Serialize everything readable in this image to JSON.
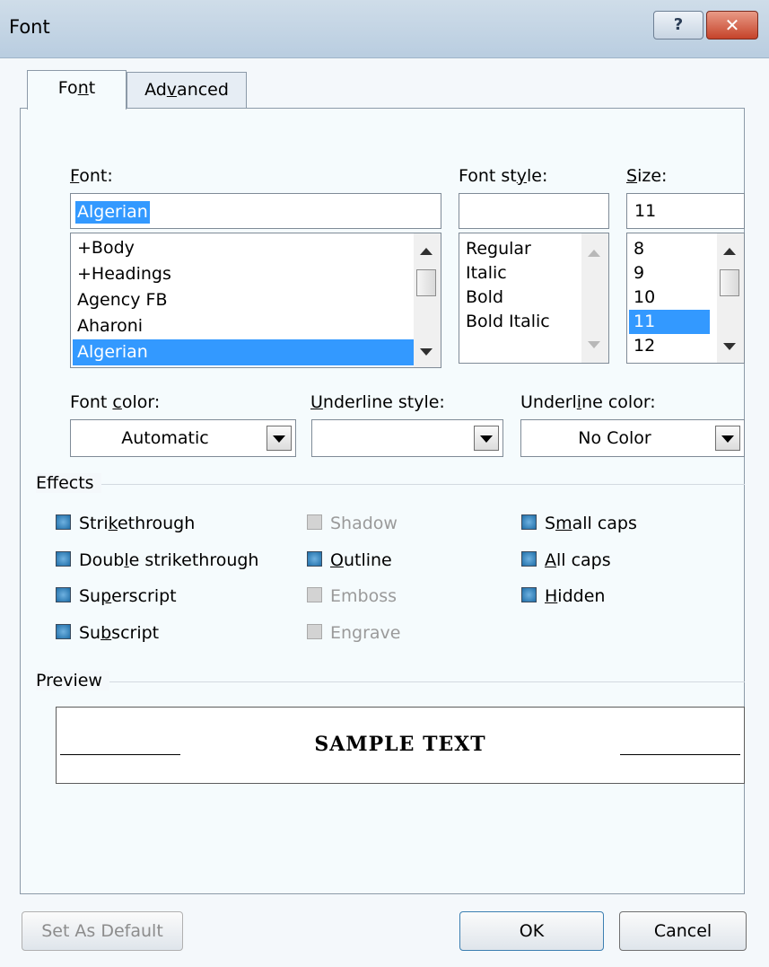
{
  "window": {
    "title": "Font",
    "help_button": "?",
    "close_button": "✕"
  },
  "tabs": [
    {
      "label": "Font",
      "mnemonic_pre": "Fo",
      "mnemonic": "n",
      "mnemonic_post": "t"
    },
    {
      "label": "Advanced",
      "mnemonic_pre": "Ad",
      "mnemonic": "v",
      "mnemonic_post": "anced"
    }
  ],
  "font": {
    "label_pre": "",
    "label_key": "F",
    "label_post": "ont:",
    "value": "Algerian",
    "items": [
      "+Body",
      "+Headings",
      "Agency FB",
      "Aharoni",
      "Algerian"
    ],
    "selected_index": 4
  },
  "font_style": {
    "label_pre": "Font st",
    "label_key": "y",
    "label_post": "le:",
    "value": "",
    "items": [
      "Regular",
      "Italic",
      "Bold",
      "Bold Italic"
    ]
  },
  "size": {
    "label_pre": "",
    "label_key": "S",
    "label_post": "ize:",
    "value": "11",
    "items": [
      "8",
      "9",
      "10",
      "11",
      "12"
    ],
    "selected_index": 3
  },
  "font_color": {
    "label_pre": "Font ",
    "label_key": "c",
    "label_post": "olor:",
    "value": "Automatic"
  },
  "underline_style": {
    "label_pre": "",
    "label_key": "U",
    "label_post": "nderline style:",
    "value": ""
  },
  "underline_color": {
    "label_pre": "Underl",
    "label_key": "i",
    "label_post": "ne color:",
    "value": "No Color"
  },
  "effects": {
    "title": "Effects",
    "items": [
      {
        "pre": "Stri",
        "key": "k",
        "post": "ethrough",
        "enabled": true
      },
      {
        "pre": "Doub",
        "key": "l",
        "post": "e strikethrough",
        "enabled": true
      },
      {
        "pre": "Su",
        "key": "p",
        "post": "erscript",
        "enabled": true
      },
      {
        "pre": "Su",
        "key": "b",
        "post": "script",
        "enabled": true
      },
      {
        "pre": "",
        "key": "",
        "post": "Shadow",
        "enabled": false
      },
      {
        "pre": "",
        "key": "O",
        "post": "utline",
        "enabled": true
      },
      {
        "pre": "",
        "key": "",
        "post": "Emboss",
        "enabled": false
      },
      {
        "pre": "",
        "key": "",
        "post": "Engrave",
        "enabled": false
      },
      {
        "pre": "S",
        "key": "m",
        "post": "all caps",
        "enabled": true
      },
      {
        "pre": "",
        "key": "A",
        "post": "ll caps",
        "enabled": true
      },
      {
        "pre": "",
        "key": "H",
        "post": "idden",
        "enabled": true
      }
    ]
  },
  "preview": {
    "title": "Preview",
    "sample_text": "SAMPLE TEXT"
  },
  "buttons": {
    "set_default": "Set As Default",
    "ok": "OK",
    "cancel": "Cancel"
  },
  "colors": {
    "selection": "#3399ff",
    "checkbox": "#1f6ea8",
    "close": "#c5432a"
  }
}
